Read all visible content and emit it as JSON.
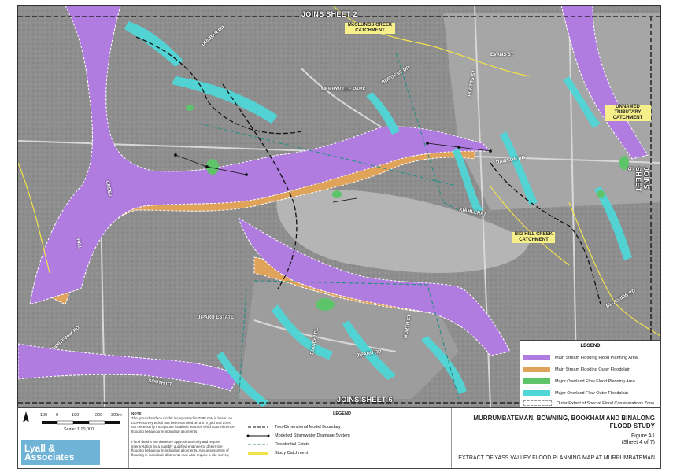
{
  "map": {
    "joins_top": "JOINS SHEET 2",
    "joins_right": "JOINS SHEET 5",
    "joins_bottom": "JOINS SHEET 6",
    "catchments": [
      {
        "text": "McCLUNGS CREEK CATCHMENT"
      },
      {
        "text": "UNNAMED TRIBUTARY CATCHMENT"
      },
      {
        "text": "BIG HILL CREEK CATCHMENT"
      }
    ],
    "areas": [
      {
        "text": "MERRYVILLE PARK"
      },
      {
        "text": "JIPARU ESTATE"
      }
    ],
    "roads": [
      "CREEK",
      "HILL",
      "LEGEND",
      "SHEET 6",
      "MERRYVILLE",
      "BURGESS DR",
      "DUNBAR DR",
      "HURTES ST",
      "EVANS ST",
      "DAWSON RD",
      "KIAMLERAT",
      "JIPARU RD",
      "NORTH ST",
      "BIANCHI PL",
      "SOUTH CT",
      "WHITEWAY RD",
      "BLUEVIEW RD"
    ]
  },
  "legend": {
    "title": "LEGEND",
    "items": [
      {
        "label": "Main Stream Flooding Flood Planning Area",
        "color": "#b07ce0"
      },
      {
        "label": "Main Stream Flooding Outer Floodplain",
        "color": "#e0a35a"
      },
      {
        "label": "Major Overland Flow Flood Planning Area",
        "color": "#5ec46a"
      },
      {
        "label": "Major Overland Flow Outer Floodplain",
        "color": "#4fd6d6"
      },
      {
        "label": "Outer Extent of Special Flood Considerations Zone",
        "color": "#dddddd"
      }
    ]
  },
  "bottom": {
    "scale_ticks": [
      "100",
      "0",
      "100",
      "200",
      "300m"
    ],
    "scale_text": "Scale: 1:10,000",
    "logo": "Lyall & Associates",
    "note_title": "NOTE:",
    "note_1": "The ground surface model incorporated in TUFLOW is based on LiDAR survey which has been sampled on a 5 m grid and does not necessarily incorporate localised features which can influence flooding behaviour in individual allotments.",
    "note_2": "Flood depths are therefore approximate only and require interpretation by a suitably qualified engineer to determine flooding behaviour in individual allotments. Any assessment of flooding in individual allotments may also require a site survey.",
    "legend_title": "LEGEND",
    "legend_items": [
      {
        "label": "Two-Dimensional Model Boundary"
      },
      {
        "label": "Modelled Stormwater Drainage System"
      },
      {
        "label": "Residential Estate"
      },
      {
        "label": "Study Catchment"
      }
    ],
    "title_1": "MURRUMBATEMAN, BOWNING, BOOKHAM AND BINALONG",
    "title_2": "FLOOD STUDY",
    "figure": "Figure A1",
    "sheet": "(Sheet 4 of 7)",
    "subtitle": "EXTRACT OF YASS VALLEY FLOOD PLANNING MAP AT MURRUMBATEMAN"
  }
}
